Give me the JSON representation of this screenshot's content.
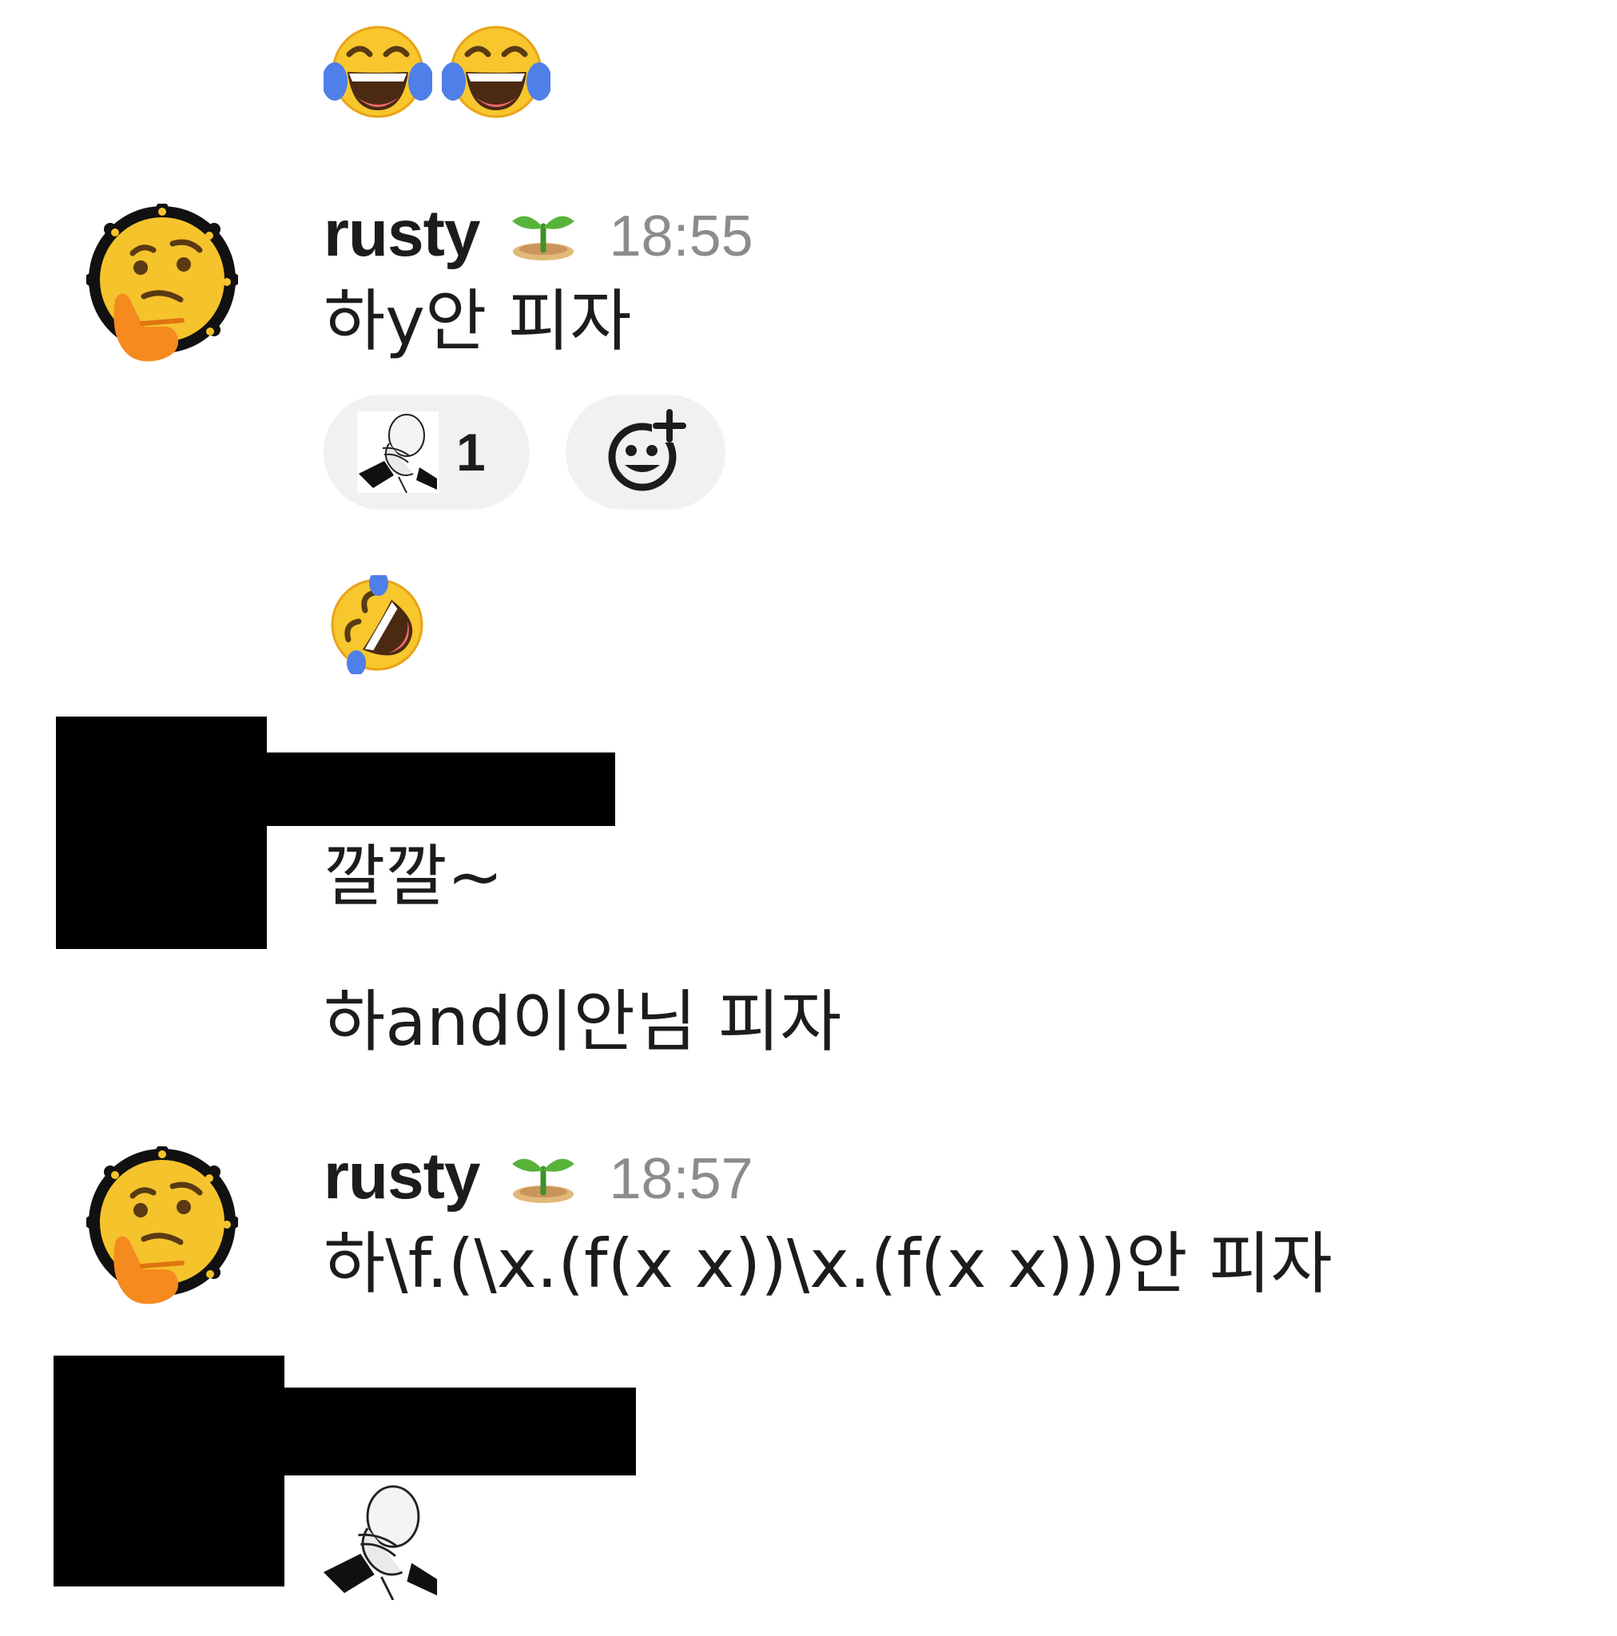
{
  "messages": [
    {
      "type": "emoji",
      "icons": [
        "face-with-tears-of-joy-icon",
        "face-with-tears-of-joy-icon"
      ]
    },
    {
      "type": "message",
      "username": "rusty",
      "status_icon": "seedling-icon",
      "time": "18:55",
      "text": "하y안 피자",
      "reactions": [
        {
          "icon": "facepalm-icon",
          "count": "1"
        }
      ],
      "add_reaction_icon": "add-reaction-icon"
    },
    {
      "type": "emoji",
      "icons": [
        "rolling-on-floor-laughing-icon"
      ]
    },
    {
      "type": "message-redacted",
      "text": "깔깔~"
    },
    {
      "type": "continuation",
      "text": "하and이안님 피자"
    },
    {
      "type": "message",
      "username": "rusty",
      "status_icon": "seedling-icon",
      "time": "18:57",
      "text": "하\\f.(\\x.(f(x x))\\x.(f(x x)))안 피자"
    },
    {
      "type": "message-redacted",
      "content_icon": "facepalm-icon"
    }
  ],
  "colors": {
    "pill_bg": "#f1f1f1",
    "timestamp": "#8d8b8d",
    "text": "#1d1c1d"
  }
}
